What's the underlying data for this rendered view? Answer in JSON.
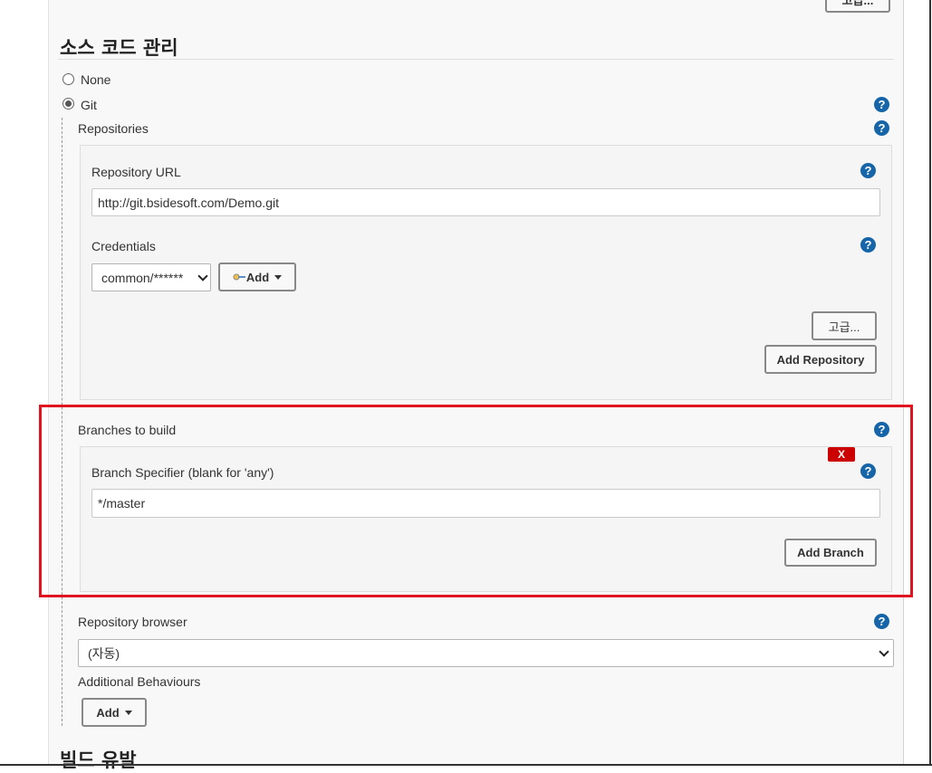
{
  "top_button_label": "고급...",
  "scm": {
    "title": "소스 코드 관리",
    "options": [
      {
        "label": "None",
        "selected": false
      },
      {
        "label": "Git",
        "selected": true
      }
    ]
  },
  "repositories": {
    "label": "Repositories",
    "repository_url_label": "Repository URL",
    "repository_url_value": "http://git.bsidesoft.com/Demo.git",
    "credentials_label": "Credentials",
    "credentials_value": "common/******",
    "add_credentials_label": "Add",
    "advanced_label": "고급...",
    "add_repository_label": "Add Repository"
  },
  "branches": {
    "label": "Branches to build",
    "delete_label": "X",
    "specifier_label": "Branch Specifier (blank for 'any')",
    "specifier_value": "*/master",
    "add_branch_label": "Add Branch"
  },
  "repository_browser": {
    "label": "Repository browser",
    "value": "(자동)"
  },
  "additional_behaviours": {
    "label": "Additional Behaviours",
    "add_label": "Add"
  },
  "next_section_title": "빌드 유발",
  "help_glyph": "?",
  "colors": {
    "help_icon": "#1565a8",
    "highlight_border": "#e0141e",
    "delete_button": "#cc0000"
  }
}
